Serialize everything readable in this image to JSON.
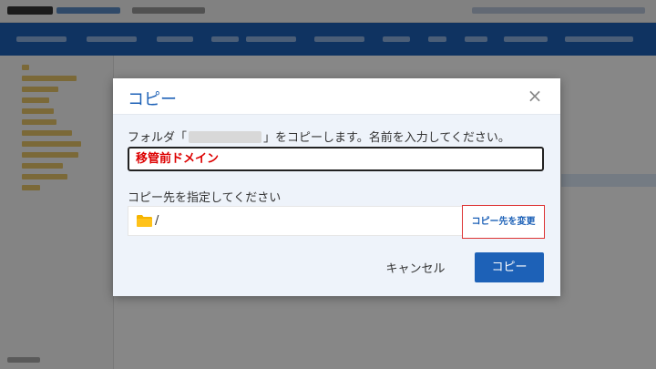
{
  "dialog": {
    "title": "コピー",
    "close_icon": "×",
    "prompt_before": "フォルダ「",
    "prompt_after": "」をコピーします。名前を入力してください。",
    "name_value": "移管前ドメイン",
    "destination_label": "コピー先を指定してください",
    "destination_icon": "folder-icon",
    "destination_path": "/",
    "change_destination_label": "コピー先を変更",
    "cancel_label": "キャンセル",
    "copy_label": "コピー"
  },
  "colors": {
    "accent": "#1d61b7",
    "name_text": "#dd0000",
    "highlight_border": "#dd3333",
    "folder": "#f5b400"
  }
}
